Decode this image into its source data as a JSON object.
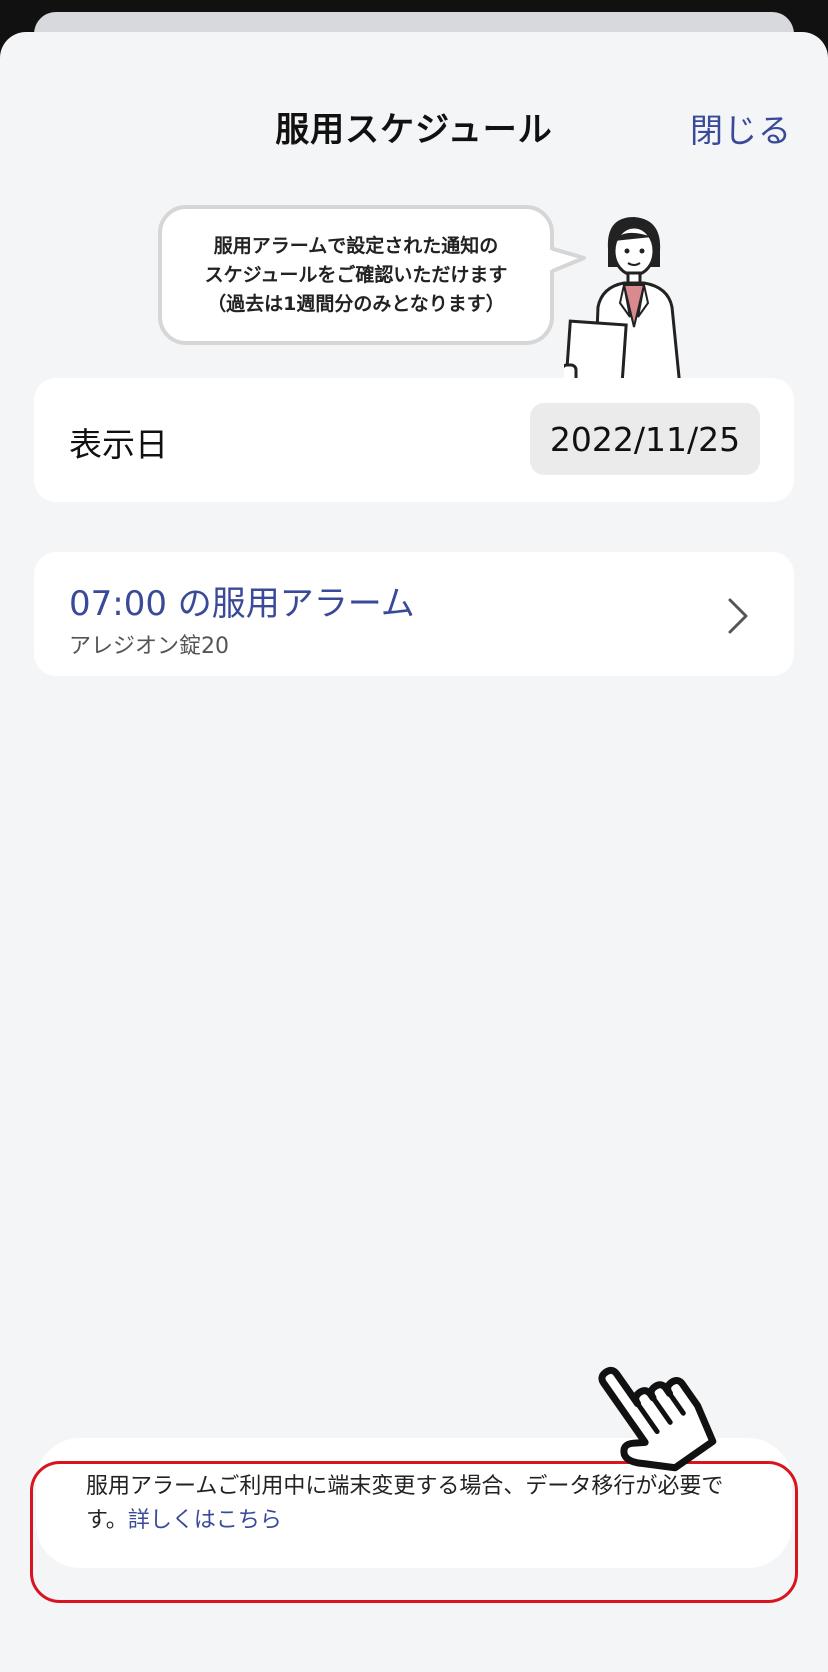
{
  "header": {
    "title": "服用スケジュール",
    "close_label": "閉じる"
  },
  "intro": {
    "bubble_text": "服用アラームで設定された通知の\nスケジュールをご確認いただけます\n（過去は1週間分のみとなります）"
  },
  "display_date": {
    "label": "表示日",
    "value": "2022/11/25"
  },
  "alarms": [
    {
      "title": "07:00 の服用アラーム",
      "drug": "アレジオン錠20"
    }
  ],
  "notice": {
    "text": "服用アラームご利用中に端末変更する場合、データ移行が必要です。",
    "link_label": "詳しくはこちら"
  },
  "colors": {
    "accent": "#3a4a98",
    "highlight": "#d9141e",
    "background": "#f4f5f7"
  }
}
